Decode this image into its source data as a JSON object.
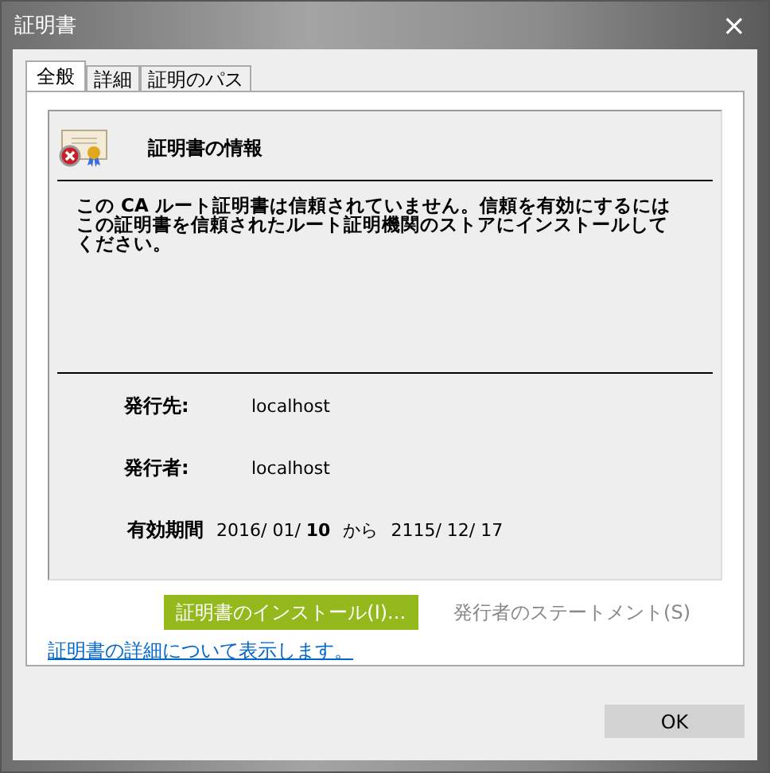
{
  "window": {
    "title": "証明書",
    "close": "×"
  },
  "tabs": [
    {
      "label": "全般",
      "selected": true
    },
    {
      "label": "詳細",
      "selected": false
    },
    {
      "label": "証明のパス",
      "selected": false
    }
  ],
  "info": {
    "heading": "証明書の情報",
    "message": "この CA ルート証明書は信頼されていません。信頼を有効にするにはこの証明書を信頼されたルート証明機関のストアにインストールしてください。"
  },
  "fields": [
    {
      "label": "発行先:",
      "value": "localhost"
    },
    {
      "label": "発行者:",
      "value": "localhost"
    }
  ],
  "validity": {
    "label": "有効期間",
    "from": "2016/ 01/ **10**",
    "word": "から",
    "to": "2115/ 12/ 17"
  },
  "buttons": [
    {
      "label": "証明書のインストール(I)...",
      "disabled": false,
      "highlighted": true
    },
    {
      "label": "発行者のステートメント(S)",
      "disabled": true,
      "highlighted": false
    }
  ],
  "link": "証明書の詳細について表示します。",
  "ok": "OK"
}
